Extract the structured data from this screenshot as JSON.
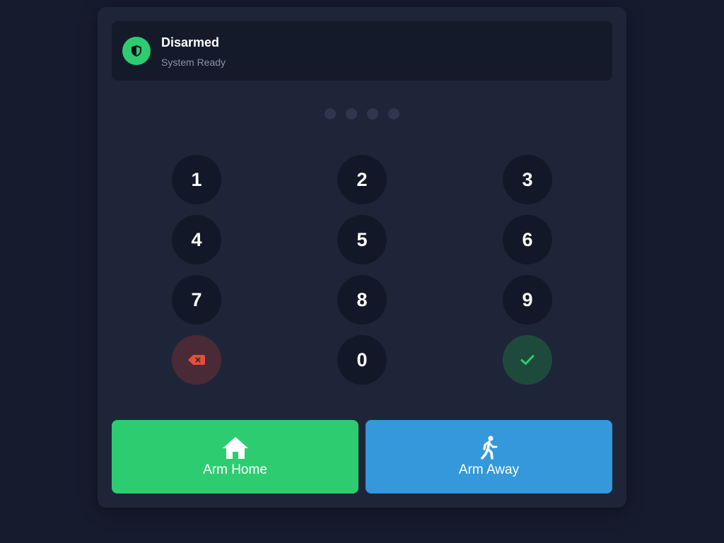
{
  "status": {
    "title": "Disarmed",
    "subtitle": "System Ready",
    "icon": "shield-icon",
    "color": "#2ecc71"
  },
  "pin": {
    "length": 4,
    "entered": 0
  },
  "keypad": {
    "keys": [
      "1",
      "2",
      "3",
      "4",
      "5",
      "6",
      "7",
      "8",
      "9",
      "0"
    ],
    "clear_icon": "backspace-icon",
    "enter_icon": "check-icon"
  },
  "actions": {
    "arm_home": {
      "label": "Arm Home",
      "icon": "home-icon",
      "color": "#2ecc71"
    },
    "arm_away": {
      "label": "Arm Away",
      "icon": "walking-person-icon",
      "color": "#3498db"
    }
  },
  "colors": {
    "background": "#161b2e",
    "panel": "#1e2538",
    "key": "#131829",
    "danger": "#e74c3c"
  }
}
